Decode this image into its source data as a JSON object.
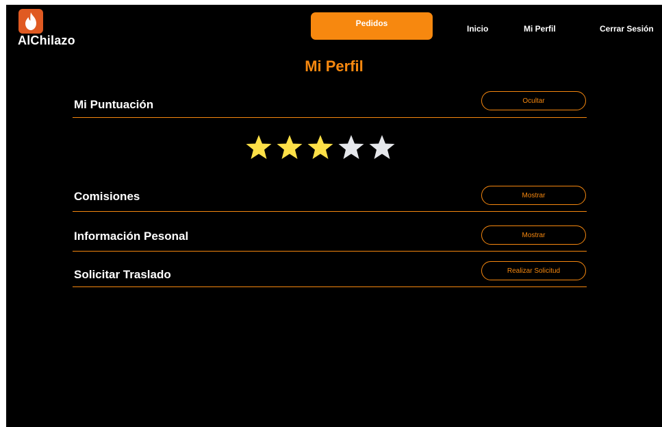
{
  "colors": {
    "accent": "#f7880f",
    "logo_bg": "#e05a22",
    "star_filled": "#fde047",
    "star_empty": "#e5e7eb"
  },
  "header": {
    "brand": "AlChilazo",
    "logo_icon": "flame-icon",
    "nav": {
      "orders": "Pedidos",
      "home": "Inicio",
      "profile": "Mi Perfil",
      "logout": "Cerrar Sesión"
    }
  },
  "page": {
    "title": "Mi Perfil"
  },
  "sections": {
    "rating": {
      "label": "Mi Puntuación",
      "button": "Ocultar"
    },
    "commissions": {
      "label": "Comisiones",
      "button": "Mostrar"
    },
    "personal_info": {
      "label": "Información Pesonal",
      "button": "Mostrar"
    },
    "transfer": {
      "label": "Solicitar Traslado",
      "button": "Realizar Solicitud"
    }
  },
  "rating": {
    "value": 3,
    "max": 5
  }
}
